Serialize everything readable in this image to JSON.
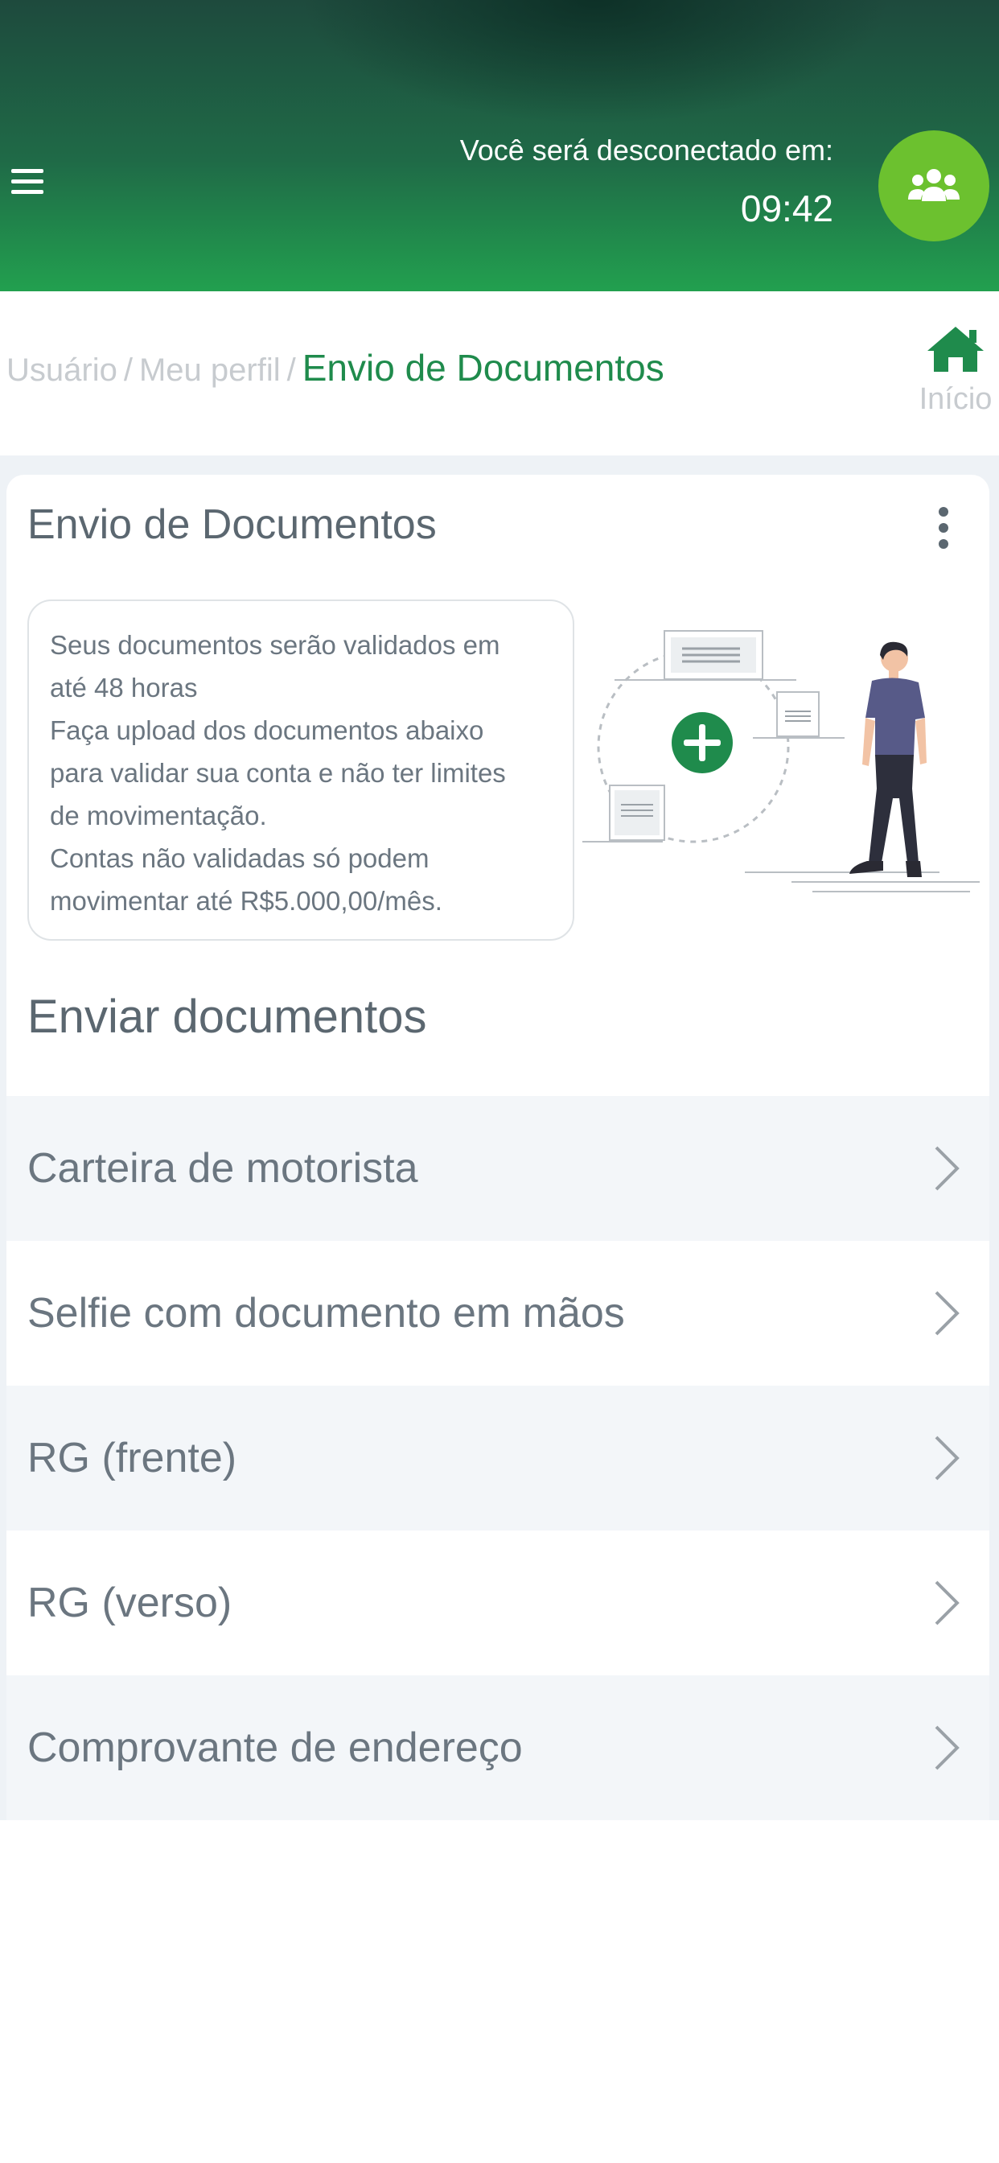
{
  "header": {
    "logout_label": "Você será desconectado em:",
    "logout_timer": "09:42",
    "menu_icon": "hamburger-menu-icon",
    "group_icon": "users-group-icon",
    "colors": {
      "gradient_top": "#1e4a3d",
      "gradient_bottom": "#22a04f",
      "group_button": "#6cc12f"
    }
  },
  "breadcrumb": {
    "items": [
      "Usuário",
      "Meu perfil"
    ],
    "separator": "/",
    "current": "Envio de Documentos"
  },
  "home": {
    "label": "Início",
    "icon": "home-icon",
    "color": "#1f8b4c"
  },
  "card": {
    "title": "Envio de Documentos",
    "menu_icon": "more-vertical-icon",
    "info_lines": [
      "Seus documentos serão validados em",
      "até 48 horas",
      "Faça upload dos documentos abaixo",
      "para validar sua conta e não ter limites",
      "de movimentação.",
      "Contas não validadas só podem",
      "movimentar até R$5.000,00/mês."
    ]
  },
  "documents": {
    "section_title": "Enviar documentos",
    "items": [
      {
        "label": "Carteira de motorista"
      },
      {
        "label": "Selfie com documento em mãos"
      },
      {
        "label": "RG (frente)"
      },
      {
        "label": "RG (verso)"
      },
      {
        "label": "Comprovante de endereço"
      }
    ],
    "chevron_icon": "chevron-right-icon"
  },
  "colors": {
    "accent": "#1f8b4c",
    "text": "#5b6770",
    "muted": "#c7cbcf",
    "background": "#eef2f6"
  }
}
